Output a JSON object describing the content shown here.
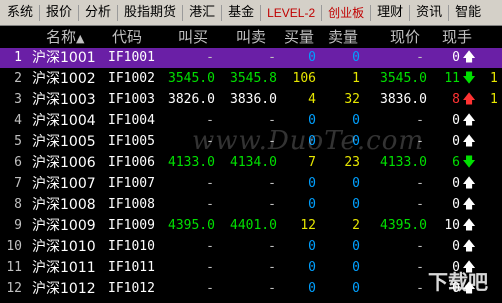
{
  "menu": {
    "items": [
      {
        "label": "系统"
      },
      {
        "label": "报价"
      },
      {
        "label": "分析"
      },
      {
        "label": "股指期货"
      },
      {
        "label": "港汇"
      },
      {
        "label": "基金"
      },
      {
        "label": "LEVEL-2",
        "highlight": true
      },
      {
        "label": "创业板",
        "highlight": true
      },
      {
        "label": "理财"
      },
      {
        "label": "资讯"
      },
      {
        "label": "智能"
      }
    ]
  },
  "header": {
    "name": "名称",
    "code": "代码",
    "bid": "叫买",
    "ask": "叫卖",
    "bid_vol": "买量",
    "ask_vol": "卖量",
    "price": "现价",
    "hand": "现手"
  },
  "rows": [
    {
      "idx": "1",
      "name": "沪深1001",
      "code": "IF1001",
      "bid": "-",
      "ask": "-",
      "bid_vol": "0",
      "ask_vol": "0",
      "price": "-",
      "hand": "0",
      "arrow": "up",
      "arrow_color": "white",
      "selected": true
    },
    {
      "idx": "2",
      "name": "沪深1002",
      "code": "IF1002",
      "bid": "3545.0",
      "ask": "3545.8",
      "bid_vol": "106",
      "ask_vol": "1",
      "price": "3545.0",
      "hand": "11",
      "arrow": "down",
      "arrow_color": "down",
      "extra": "1"
    },
    {
      "idx": "3",
      "name": "沪深1003",
      "code": "IF1003",
      "bid": "3826.0",
      "ask": "3836.0",
      "bid_vol": "4",
      "ask_vol": "32",
      "price": "3836.0",
      "hand": "8",
      "arrow": "up",
      "arrow_color": "up",
      "extra": "1"
    },
    {
      "idx": "4",
      "name": "沪深1004",
      "code": "IF1004",
      "bid": "-",
      "ask": "-",
      "bid_vol": "0",
      "ask_vol": "0",
      "price": "-",
      "hand": "0",
      "arrow": "up",
      "arrow_color": "white"
    },
    {
      "idx": "5",
      "name": "沪深1005",
      "code": "IF1005",
      "bid": "-",
      "ask": "-",
      "bid_vol": "0",
      "ask_vol": "0",
      "price": "-",
      "hand": "0",
      "arrow": "up",
      "arrow_color": "white"
    },
    {
      "idx": "6",
      "name": "沪深1006",
      "code": "IF1006",
      "bid": "4133.0",
      "ask": "4134.0",
      "bid_vol": "7",
      "ask_vol": "23",
      "price": "4133.0",
      "hand": "6",
      "arrow": "down",
      "arrow_color": "down"
    },
    {
      "idx": "7",
      "name": "沪深1007",
      "code": "IF1007",
      "bid": "-",
      "ask": "-",
      "bid_vol": "0",
      "ask_vol": "0",
      "price": "-",
      "hand": "0",
      "arrow": "up",
      "arrow_color": "white"
    },
    {
      "idx": "8",
      "name": "沪深1008",
      "code": "IF1008",
      "bid": "-",
      "ask": "-",
      "bid_vol": "0",
      "ask_vol": "0",
      "price": "-",
      "hand": "0",
      "arrow": "up",
      "arrow_color": "white"
    },
    {
      "idx": "9",
      "name": "沪深1009",
      "code": "IF1009",
      "bid": "4395.0",
      "ask": "4401.0",
      "bid_vol": "12",
      "ask_vol": "2",
      "price": "4395.0",
      "hand": "10",
      "arrow": "up",
      "arrow_color": "white"
    },
    {
      "idx": "10",
      "name": "沪深1010",
      "code": "IF1010",
      "bid": "-",
      "ask": "-",
      "bid_vol": "0",
      "ask_vol": "0",
      "price": "-",
      "hand": "0",
      "arrow": "up",
      "arrow_color": "white"
    },
    {
      "idx": "11",
      "name": "沪深1011",
      "code": "IF1011",
      "bid": "-",
      "ask": "-",
      "bid_vol": "0",
      "ask_vol": "0",
      "price": "-",
      "hand": "0",
      "arrow": "up",
      "arrow_color": "white"
    },
    {
      "idx": "12",
      "name": "沪深1012",
      "code": "IF1012",
      "bid": "-",
      "ask": "-",
      "bid_vol": "0",
      "ask_vol": "0",
      "price": "-",
      "hand": "0",
      "arrow": "up",
      "arrow_color": "white"
    }
  ],
  "colors": {
    "up": "#ff3232",
    "down": "#00e000",
    "selected_row": "#6a1fa6",
    "zero": "#00a0ff",
    "volume": "#e6e600"
  },
  "watermark": {
    "text": "www.DuoTe.com",
    "corner": "下载吧"
  }
}
